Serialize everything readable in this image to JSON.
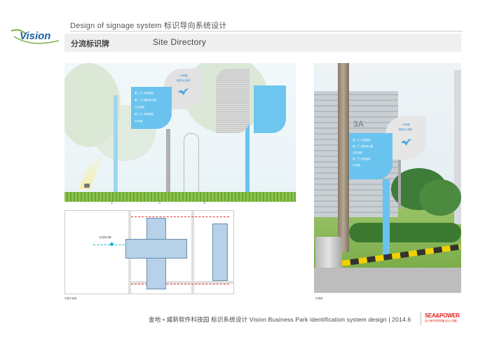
{
  "header": {
    "logo_text": "Vision",
    "doc_title": "Design of signage system  标识导向系统设计",
    "section_cn": "分流标识牌",
    "section_en": "Site Directory"
  },
  "elevation": {
    "sign_lines": [
      "第二门 | 科技园区",
      "第二门 | 国际部大楼",
      "万达传媒",
      "第二门 | 科技园区",
      "5G传媒"
    ],
    "bird_text": [
      "5G传媒",
      "服务中心/餐厅"
    ],
    "markers": [
      "1",
      "2",
      "3"
    ]
  },
  "map": {
    "label": "分流导示牌",
    "caption": "位置平面图"
  },
  "photo": {
    "sign_lines": [
      "第二门 | 科技园区",
      "第二门 | 国际部大楼",
      "万达传媒",
      "第二门 | 科技园区",
      "5G传媒"
    ],
    "bird_text": [
      "5G传媒",
      "服务中心/餐厅"
    ],
    "building_text": "3A",
    "caption": "效果图"
  },
  "footer": {
    "text": "金地 • 威新软件科技园 标识系统设计  Vision Business Park  identification system design | 2014.6",
    "brand": "SEA&POWER",
    "brand_sub": "四川海光视觉传播 (四川·成都)"
  },
  "colors": {
    "accent_blue": "#69c3ee",
    "brand_red": "#e2231a",
    "logo_blue": "#1f5fa8",
    "logo_green": "#7cb342"
  }
}
